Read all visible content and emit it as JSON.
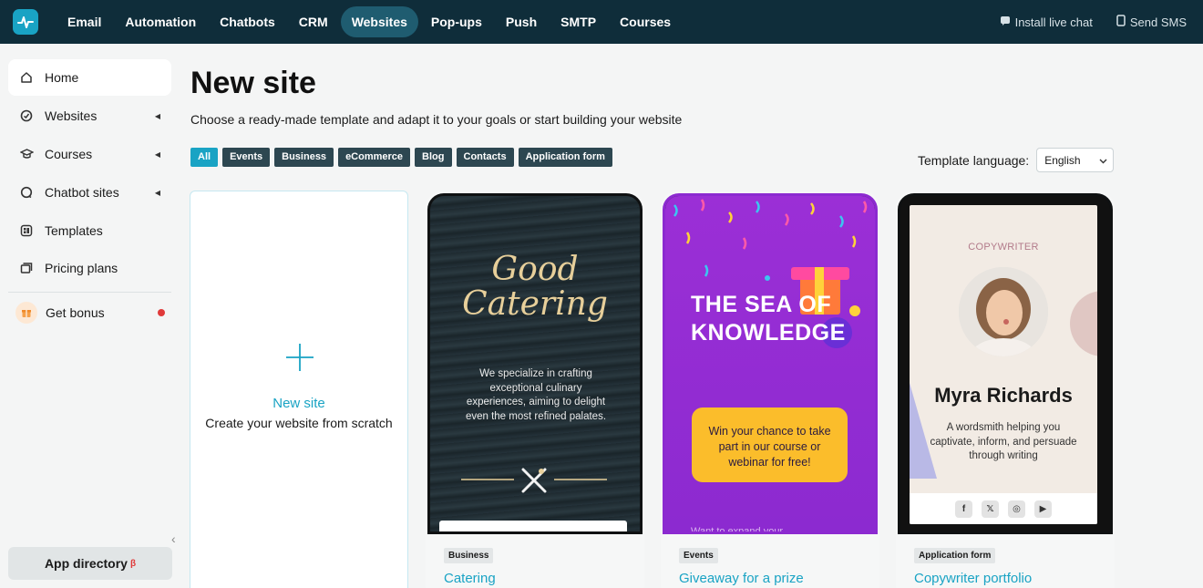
{
  "topnav": {
    "items": [
      "Email",
      "Automation",
      "Chatbots",
      "CRM",
      "Websites",
      "Pop-ups",
      "Push",
      "SMTP",
      "Courses"
    ],
    "active": "Websites",
    "install_live_chat": "Install live chat",
    "send_sms": "Send SMS"
  },
  "sidebar": {
    "items": [
      {
        "label": "Home",
        "icon": "home-icon"
      },
      {
        "label": "Websites",
        "icon": "websites-icon"
      },
      {
        "label": "Courses",
        "icon": "graduation-cap-icon"
      },
      {
        "label": "Chatbot sites",
        "icon": "chat-icon"
      },
      {
        "label": "Templates",
        "icon": "templates-icon"
      },
      {
        "label": "Pricing plans",
        "icon": "pricing-icon"
      }
    ],
    "bonus": "Get bonus",
    "app_directory": "App directory",
    "app_directory_badge": "β"
  },
  "main": {
    "title": "New site",
    "subtitle": "Choose a ready-made template and adapt it to your goals or start building your website",
    "filters": [
      "All",
      "Events",
      "Business",
      "eCommerce",
      "Blog",
      "Contacts",
      "Application form"
    ],
    "active_filter": "All",
    "language_label": "Template language:",
    "language_value": "English"
  },
  "new_site": {
    "title": "New site",
    "subtitle": "Create your website from scratch"
  },
  "templates": [
    {
      "tag": "Business",
      "name": "Catering",
      "preview_title_1": "Good",
      "preview_title_2": "Catering",
      "preview_text": "We specialize in crafting exceptional culinary experiences, aiming to delight even the most refined palates."
    },
    {
      "tag": "Events",
      "name": "Giveaway for a prize",
      "preview_title_1": "THE SEA OF",
      "preview_title_2": "KNOWLEDGE",
      "preview_text": "Win your chance to take part in our course or webinar for free!",
      "preview_foot": "Want to expand your"
    },
    {
      "tag": "Application form",
      "name": "Copywriter portfolio",
      "preview_label": "COPYWRITER",
      "preview_name": "Myra Richards",
      "preview_text": "A wordsmith helping you captivate, inform, and persuade through writing"
    }
  ],
  "colors": {
    "nav_bg": "#0f2d3a",
    "accent": "#19a3c4",
    "filter_bg": "#2d4751"
  }
}
